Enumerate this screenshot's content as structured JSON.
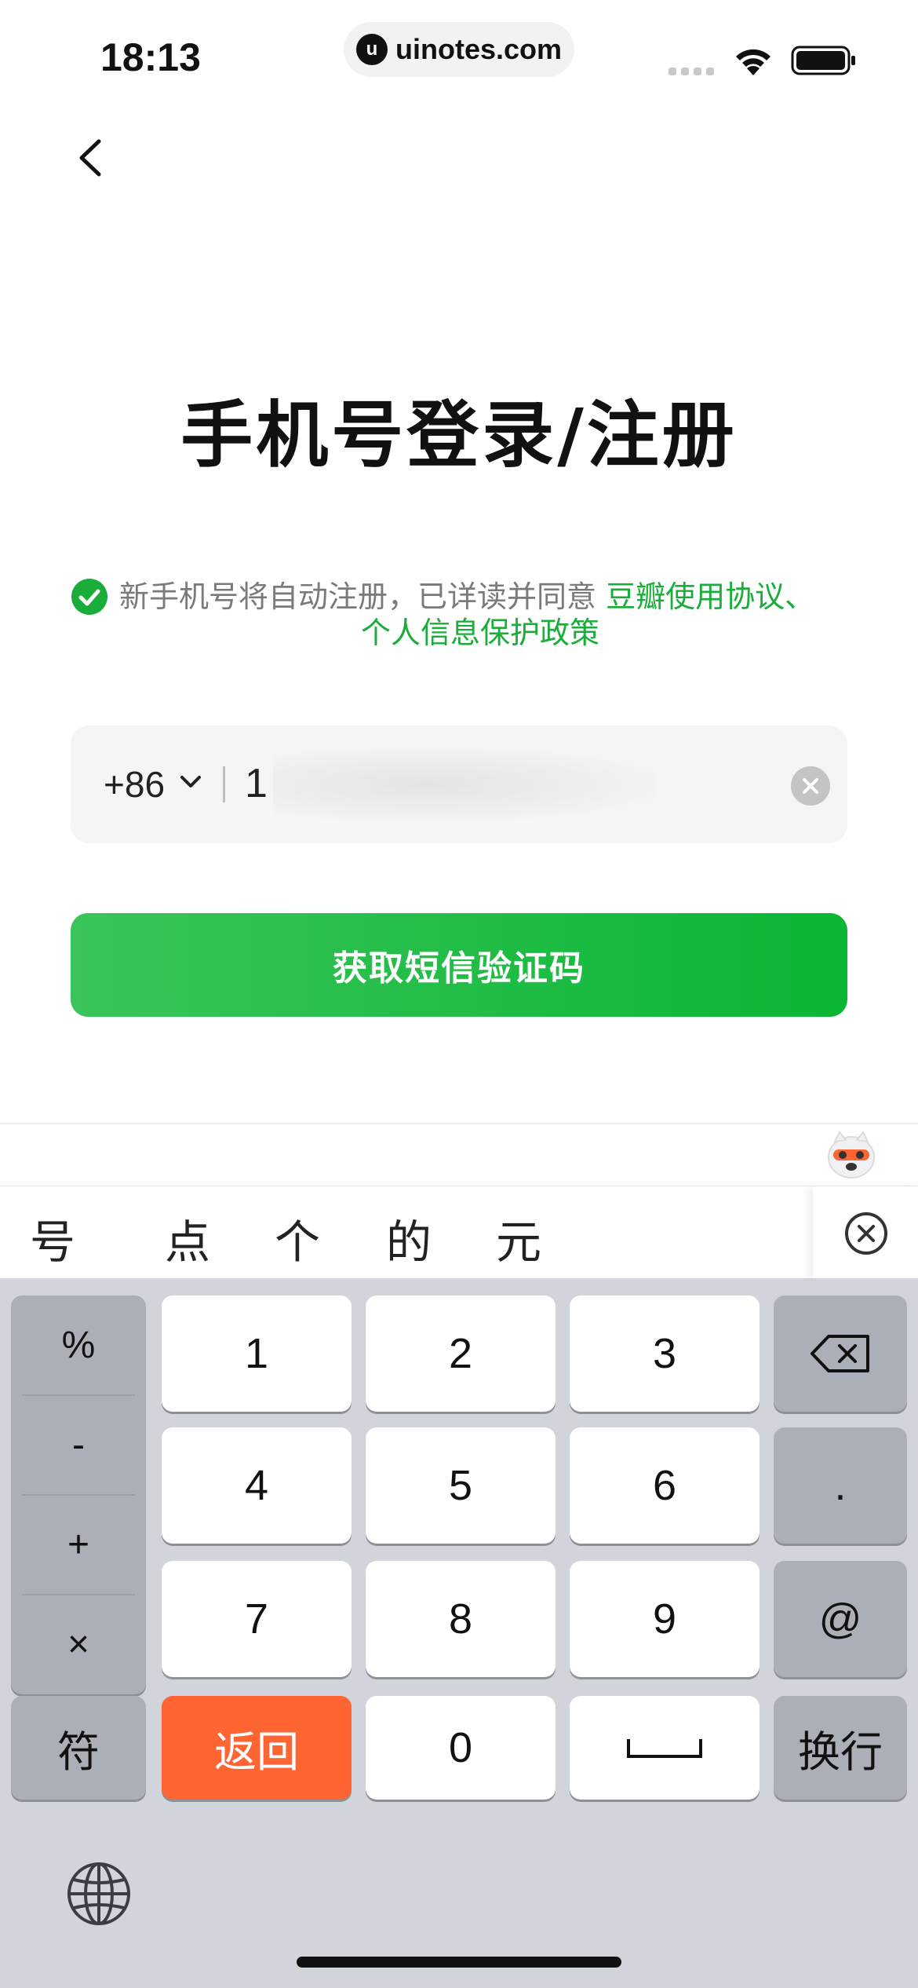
{
  "status_bar": {
    "time": "18:13",
    "url_logo_letter": "u",
    "url": "uinotes.com"
  },
  "title": "手机号登录/注册",
  "agreement": {
    "checked": true,
    "text": "新手机号将自动注册，已详读并同意",
    "link1": "豆瓣使用协议、",
    "link2": "个人信息保护政策",
    "link_color": "#1aad3a"
  },
  "phone_input": {
    "country_code": "+86",
    "value_visible": "1"
  },
  "submit_button": {
    "label": "获取短信验证码",
    "color": "#0ab634"
  },
  "candidates": [
    "号",
    "点",
    "个",
    "的",
    "元"
  ],
  "keyboard": {
    "symbols": [
      "%",
      "-",
      "+",
      "×"
    ],
    "digits": [
      "1",
      "2",
      "3",
      "4",
      "5",
      "6",
      "7",
      "8",
      "9",
      "0"
    ],
    "dot": ".",
    "at": "@",
    "symbol_key": "符",
    "return_key": "返回",
    "newline_key": "换行",
    "return_color": "#ff6532"
  }
}
